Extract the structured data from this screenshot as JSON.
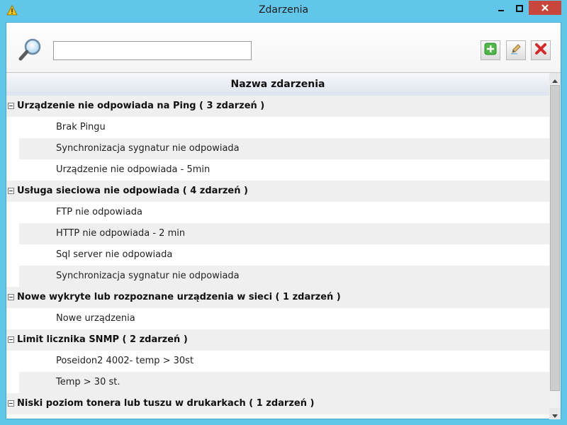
{
  "window": {
    "title": "Zdarzenia",
    "icon": "warning-icon",
    "controls": [
      "minimize-icon",
      "maximize-icon",
      "close-icon"
    ],
    "colors": {
      "frame": "#62c6ea",
      "close": "#c9463d"
    }
  },
  "toolbar": {
    "search_value": "",
    "icons": {
      "search": "magnifier-icon",
      "add": "plus-icon",
      "edit": "pencil-icon",
      "delete": "x-icon"
    }
  },
  "table": {
    "header": "Nazwa zdarzenia",
    "groups": [
      {
        "label": "Urządzenie nie odpowiada na Ping ( 3 zdarzeń )",
        "items": [
          "Brak Pingu",
          "Synchronizacja sygnatur nie odpowiada",
          "Urządzenie nie odpowiada - 5min"
        ]
      },
      {
        "label": "Usługa sieciowa nie odpowiada ( 4 zdarzeń )",
        "items": [
          "FTP nie odpowiada",
          "HTTP nie odpowiada - 2 min",
          "Sql server nie odpowiada",
          "Synchronizacja sygnatur nie odpowiada"
        ]
      },
      {
        "label": "Nowe wykryte lub rozpoznane urządzenia w sieci ( 1 zdarzeń )",
        "items": [
          "Nowe urządzenia"
        ]
      },
      {
        "label": "Limit licznika SNMP ( 2 zdarzeń )",
        "items": [
          "Poseidon2 4002- temp > 30st",
          "Temp > 30 st."
        ]
      },
      {
        "label": "Niski poziom tonera lub tuszu w drukarkach ( 1 zdarzeń )",
        "items": []
      }
    ]
  }
}
